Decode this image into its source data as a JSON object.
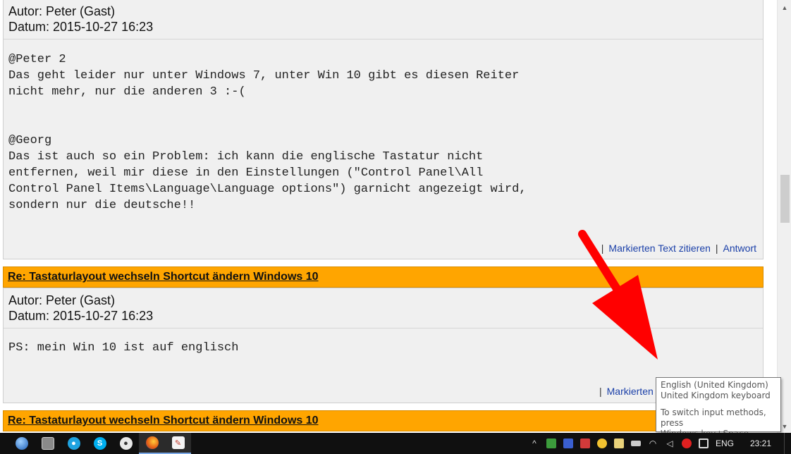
{
  "posts": [
    {
      "author": "Autor: Peter (Gast)",
      "date": "Datum: 2015-10-27 16:23",
      "body": "@Peter 2\nDas geht leider nur unter Windows 7, unter Win 10 gibt es diesen Reiter\nnicht mehr, nur die anderen 3 :-(\n\n\n@Georg\nDas ist auch so ein Problem: ich kann die englische Tastatur nicht\nentfernen, weil mir diese in den Einstellungen (\"Control Panel\\All\nControl Panel Items\\Language\\Language options\") garnicht angezeigt wird,\nsondern nur die deutsche!!",
      "quote_link": "Markierten Text zitieren",
      "reply_link": "Antwort"
    },
    {
      "title": "Re: Tastaturlayout wechseln Shortcut ändern Windows 10",
      "author": "Autor: Peter (Gast)",
      "date": "Datum: 2015-10-27 16:23",
      "body": "PS: mein Win 10 ist auf englisch",
      "quote_link": "Markierten T"
    },
    {
      "title": "Re: Tastaturlayout wechseln Shortcut ändern Windows 10"
    }
  ],
  "separator": "|",
  "tooltip": {
    "line1": "English (United Kingdom)",
    "line2": "United Kingdom keyboard",
    "line3": "To switch input methods, press",
    "line4": "Windows key+Space."
  },
  "taskbar": {
    "apps": [
      "start-icon",
      "calculator-icon",
      "search-icon",
      "skype-icon",
      "network-icon",
      "firefox-icon",
      "paint-icon"
    ],
    "tray_chevron": "^",
    "language": "ENG",
    "clock": "23:21"
  },
  "colors": {
    "accent": "#ffa500",
    "link": "#1a3fa8",
    "arrow": "#ff0000"
  }
}
